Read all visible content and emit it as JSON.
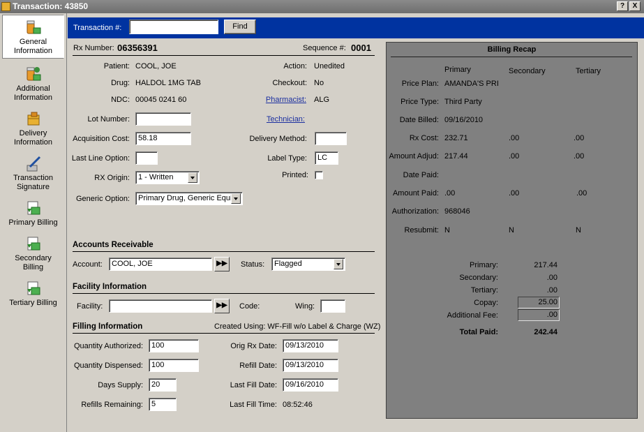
{
  "window": {
    "title": "Transaction: 43850",
    "help_label": "?",
    "close_label": "X"
  },
  "sidebar": {
    "items": [
      {
        "label": "General\nInformation",
        "icon": "pills-icon"
      },
      {
        "label": "Additional\nInformation",
        "icon": "pills-add-icon"
      },
      {
        "label": "Delivery\nInformation",
        "icon": "box-icon"
      },
      {
        "label": "Transaction\nSignature",
        "icon": "pen-icon"
      },
      {
        "label": "Primary Billing",
        "icon": "billing-icon"
      },
      {
        "label": "Secondary\nBilling",
        "icon": "billing-icon"
      },
      {
        "label": "Tertiary Billing",
        "icon": "billing-icon"
      }
    ]
  },
  "search": {
    "label": "Transaction #:",
    "value": "",
    "find_label": "Find"
  },
  "rx": {
    "number_label": "Rx Number:",
    "number": "06356391",
    "sequence_label": "Sequence #:",
    "sequence": "0001",
    "patient_label": "Patient:",
    "patient": "COOL, JOE",
    "drug_label": "Drug:",
    "drug": "HALDOL 1MG TAB",
    "ndc_label": "NDC:",
    "ndc": "00045 0241 60",
    "lot_label": "Lot Number:",
    "lot": "",
    "acq_label": "Acquisition Cost:",
    "acq": "58.18",
    "lastline_label": "Last Line Option:",
    "lastline": "",
    "origin_label": "RX Origin:",
    "origin": "1 - Written",
    "generic_label": "Generic Option:",
    "generic": "Primary Drug, Generic Equiv",
    "action_label": "Action:",
    "action": "Unedited",
    "checkout_label": "Checkout:",
    "checkout": "No",
    "pharmacist_label": "Pharmacist:",
    "pharmacist": "ALG",
    "technician_label": "Technician:",
    "delivery_label": "Delivery Method:",
    "delivery": "",
    "labeltype_label": "Label Type:",
    "labeltype": "LC",
    "printed_label": "Printed:"
  },
  "ar": {
    "title": "Accounts Receivable",
    "account_label": "Account:",
    "account": "COOL, JOE",
    "status_label": "Status:",
    "status": "Flagged"
  },
  "facility": {
    "title": "Facility Information",
    "facility_label": "Facility:",
    "facility": "",
    "code_label": "Code:",
    "wing_label": "Wing:",
    "wing": ""
  },
  "filling": {
    "title": "Filling Information",
    "created": "Created Using: WF-Fill w/o Label & Charge (WZ)",
    "qa_label": "Quantity Authorized:",
    "qa": "100",
    "qd_label": "Quantity Dispensed:",
    "qd": "100",
    "days_label": "Days Supply:",
    "days": "20",
    "refills_label": "Refills Remaining:",
    "refills": "5",
    "orig_label": "Orig Rx Date:",
    "orig": "09/13/2010",
    "refill_label": "Refill Date:",
    "refill": "09/13/2010",
    "lastfill_label": "Last Fill Date:",
    "lastfill": "09/16/2010",
    "lasttime_label": "Last Fill Time:",
    "lasttime": "08:52:46"
  },
  "recap": {
    "title": "Billing Recap",
    "col_primary": "Primary",
    "col_secondary": "Secondary",
    "col_tertiary": "Tertiary",
    "plan_label": "Price Plan:",
    "plan": "AMANDA'S PRI",
    "type_label": "Price Type:",
    "type": "Third Party",
    "billed_label": "Date Billed:",
    "billed": "09/16/2010",
    "cost_label": "Rx Cost:",
    "cost_p": "232.71",
    "cost_s": ".00",
    "cost_t": ".00",
    "adj_label": "Amount Adjud:",
    "adj_p": "217.44",
    "adj_s": ".00",
    "adj_t": ".00",
    "paiddate_label": "Date Paid:",
    "amtpaid_label": "Amount Paid:",
    "amtpaid_p": ".00",
    "amtpaid_s": ".00",
    "amtpaid_t": ".00",
    "auth_label": "Authorization:",
    "auth": "968046",
    "resubmit_label": "Resubmit:",
    "resub_p": "N",
    "resub_s": "N",
    "resub_t": "N",
    "sum_primary_label": "Primary:",
    "sum_primary": "217.44",
    "sum_secondary_label": "Secondary:",
    "sum_secondary": ".00",
    "sum_tertiary_label": "Tertiary:",
    "sum_tertiary": ".00",
    "copay_label": "Copay:",
    "copay": "25.00",
    "addfee_label": "Additional Fee:",
    "addfee": ".00",
    "total_label": "Total Paid:",
    "total": "242.44"
  }
}
